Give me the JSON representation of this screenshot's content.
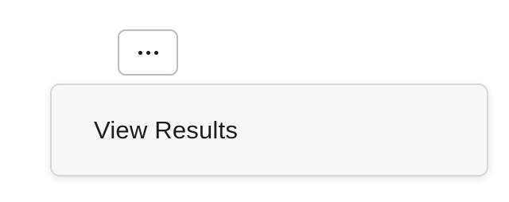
{
  "toolbar": {
    "more_icon": "more-horizontal-icon"
  },
  "menu": {
    "items": [
      {
        "label": "View Results"
      }
    ]
  }
}
